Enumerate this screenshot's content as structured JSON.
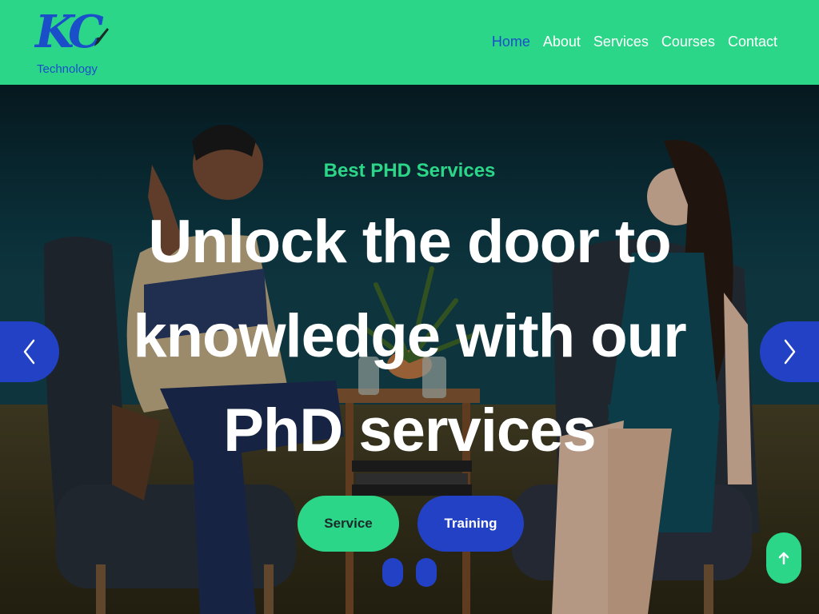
{
  "brand": {
    "logo_text": "KC",
    "logo_subtext": "Technology"
  },
  "nav": {
    "items": [
      {
        "label": "Home",
        "active": true
      },
      {
        "label": "About",
        "active": false
      },
      {
        "label": "Services",
        "active": false
      },
      {
        "label": "Courses",
        "active": false
      },
      {
        "label": "Contact",
        "active": false
      }
    ]
  },
  "hero": {
    "subtitle": "Best PHD Services",
    "title": "Unlock the door to knowledge with our PhD services",
    "buttons": {
      "service": "Service",
      "training": "Training"
    },
    "prev_icon": "chevron-left-icon",
    "next_icon": "chevron-right-icon",
    "slide_count": 2
  },
  "back_to_top": {
    "icon": "arrow-up-icon"
  },
  "colors": {
    "accent_green": "#2cd688",
    "accent_blue": "#2341c4",
    "logo_blue": "#1a4fc9"
  }
}
